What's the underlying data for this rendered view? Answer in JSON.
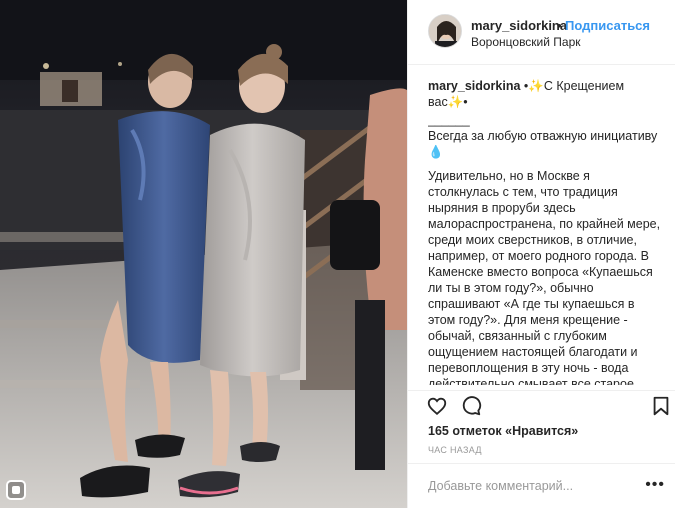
{
  "post": {
    "username": "mary_sidorkina",
    "follow_label": "Подписаться",
    "separator": "•",
    "location": "Воронцовский Парк"
  },
  "caption": {
    "username": "mary_sidorkina",
    "title": "•✨С Крещением вас✨•",
    "separator": "______",
    "subtitle": "Всегда за любую отважную инициативу💧",
    "body": "Удивительно, но в Москве я столкнулась с тем, что традиция ныряния в проруби здесь малораспространена, по крайней мере, среди моих сверстников, в отличие, например, от моего родного города. В Каменске вместо вопроса «Купаешься ли ты в этом году?», обычно спрашивают «А где ты купаешься в этом году?». Для меня крещение - обычай, связанный с глубоким ощущением настоящей благодати и перевоплощения в эту ночь - вода действительно смывает все старое, неправильное, грешное. И я рада, что в эту ночь я коснулась чего-то волшебного и священного одновременно. Уже с нетерпением жду следующий год и рада буду увидеть рядом всех тех, у кого не"
  },
  "stats": {
    "likes_text": "165 отметок «Нравится»",
    "time_ago": "ЧАС НАЗАД"
  },
  "comment": {
    "placeholder": "Добавьте комментарий...",
    "more": "•••"
  },
  "icons": {
    "like": "heart-icon",
    "comment": "comment-icon",
    "save": "bookmark-icon",
    "badge": "igtv-icon"
  },
  "colors": {
    "follow": "#3897f0",
    "text": "#262626",
    "muted": "#999999"
  }
}
